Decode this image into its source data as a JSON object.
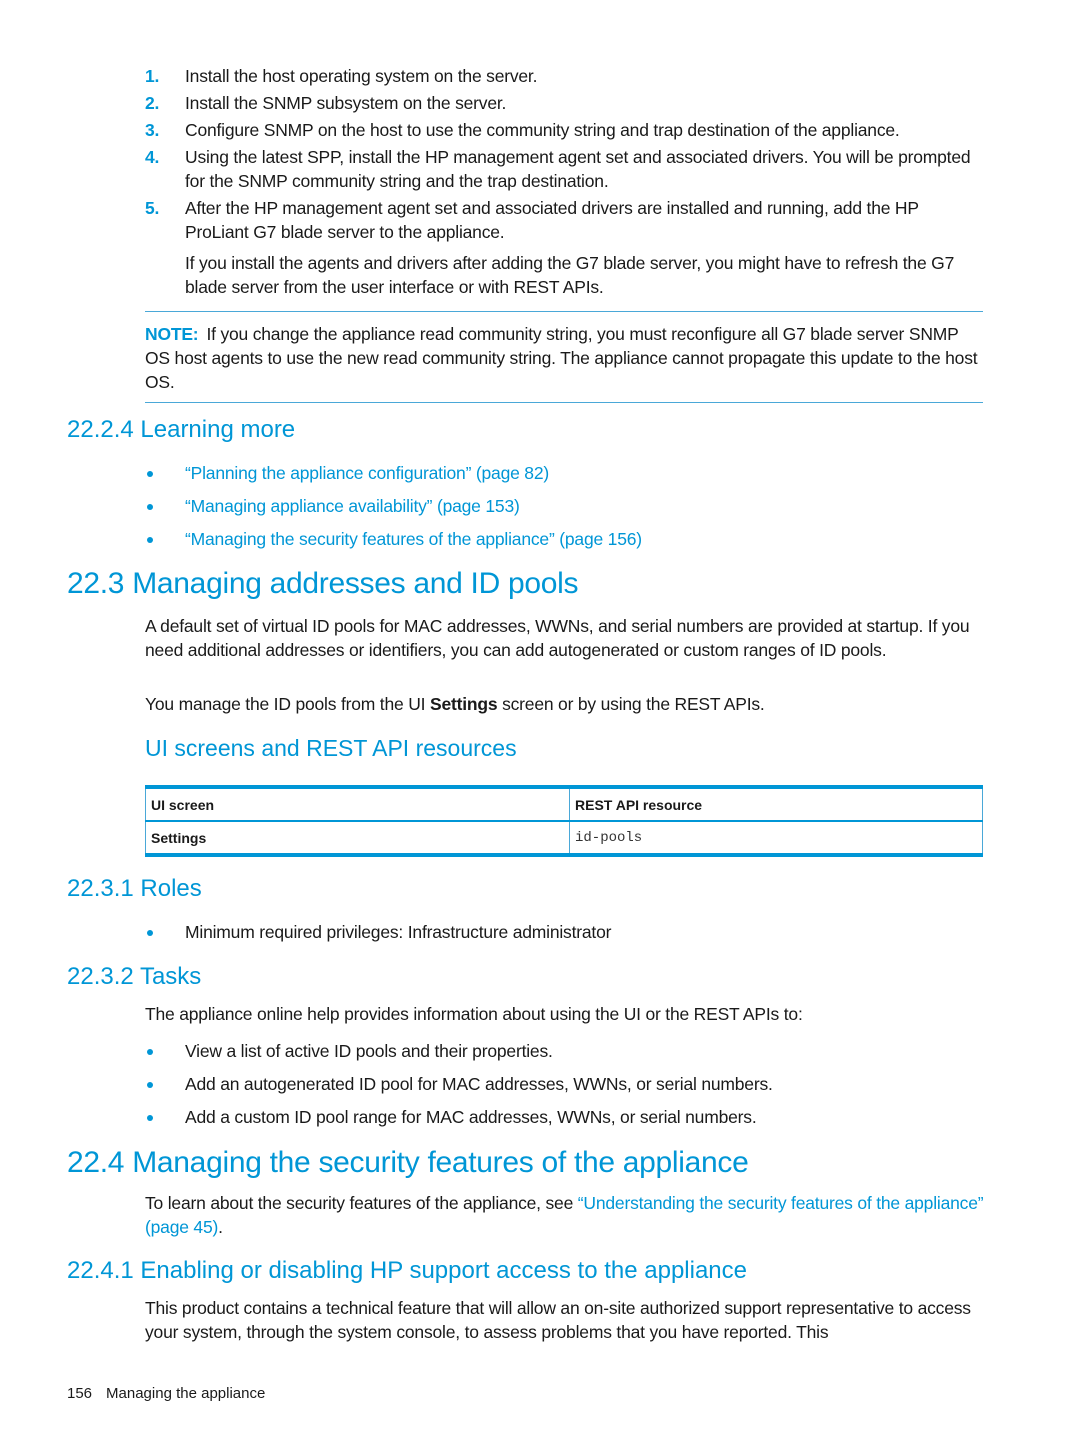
{
  "steps": [
    {
      "num": "1.",
      "text": "Install the host operating system on the server."
    },
    {
      "num": "2.",
      "text": "Install the SNMP subsystem on the server."
    },
    {
      "num": "3.",
      "text": "Configure SNMP on the host to use the community string and trap destination of the appliance."
    },
    {
      "num": "4.",
      "text": "Using the latest SPP, install the HP management agent set and associated drivers. You will be prompted for the SNMP community string and the trap destination."
    },
    {
      "num": "5.",
      "text": "After the HP management agent set and associated drivers are installed and running, add the HP ProLiant G7 blade server to the appliance."
    }
  ],
  "step5_followup": "If you install the agents and drivers after adding the G7 blade server, you might have to refresh the G7 blade server from the user interface or with REST APIs.",
  "note": {
    "label": "NOTE:",
    "text": "If you change the appliance read community string, you must reconfigure all G7 blade server SNMP OS host agents to use the new read community string. The appliance cannot propagate this update to the host OS."
  },
  "learning_more": {
    "heading": "22.2.4 Learning more",
    "links": [
      "“Planning the appliance configuration” (page 82)",
      "“Managing appliance availability” (page 153)",
      "“Managing the security features of the appliance” (page 156)"
    ]
  },
  "section_22_3": {
    "heading": "22.3 Managing addresses and ID pools",
    "para1": "A default set of virtual ID pools for MAC addresses, WWNs, and serial numbers are provided at startup. If you need additional addresses or identifiers, you can add autogenerated or custom ranges of ID pools.",
    "para2_before": "You manage the ID pools from the UI ",
    "para2_bold": "Settings",
    "para2_after": " screen or by using the REST APIs.",
    "table_heading": "UI screens and REST API resources",
    "table": {
      "headers": [
        "UI screen",
        "REST API resource"
      ],
      "rows": [
        [
          "Settings",
          "id-pools"
        ]
      ]
    }
  },
  "roles": {
    "heading": "22.3.1 Roles",
    "items": [
      "Minimum required privileges: Infrastructure administrator"
    ]
  },
  "tasks": {
    "heading": "22.3.2 Tasks",
    "intro": "The appliance online help provides information about using the UI or the REST APIs to:",
    "items": [
      "View a list of active ID pools and their properties.",
      "Add an autogenerated ID pool for MAC addresses, WWNs, or serial numbers.",
      "Add a custom ID pool range for MAC addresses, WWNs, or serial numbers."
    ]
  },
  "section_22_4": {
    "heading": "22.4 Managing the security features of the appliance",
    "para_before": "To learn about the security features of the appliance, see ",
    "para_link": "“Understanding the security features of the appliance” (page 45)",
    "para_after": "."
  },
  "section_22_4_1": {
    "heading": "22.4.1 Enabling or disabling HP support access to the appliance",
    "para": "This product contains a technical feature that will allow an on-site authorized support representative to access your system, through the system console, to assess problems that you have reported. This"
  },
  "footer": {
    "page_number": "156",
    "chapter": "Managing the appliance"
  },
  "colors": {
    "accent": "#0096d6",
    "text": "#1a1a1a"
  }
}
